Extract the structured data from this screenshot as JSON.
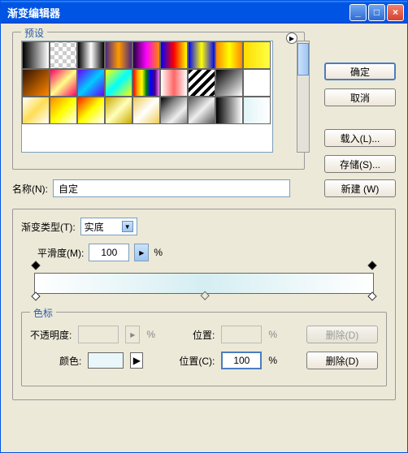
{
  "titlebar": {
    "title": "渐变编辑器"
  },
  "buttons": {
    "ok": "确定",
    "cancel": "取消",
    "load": "载入(L)...",
    "save": "存储(S)...",
    "new": "新建 (W)",
    "delete_opacity": "删除(D)",
    "delete_color": "删除(D)"
  },
  "presets": {
    "legend": "预设"
  },
  "name": {
    "label": "名称(N):",
    "value": "自定"
  },
  "gradient": {
    "type_label": "渐变类型(T):",
    "type_value": "实底",
    "smooth_label": "平滑度(M):",
    "smooth_value": "100",
    "smooth_unit": "%"
  },
  "stops": {
    "legend": "色标",
    "opacity_label": "不透明度:",
    "opacity_value": "",
    "opacity_unit": "%",
    "opacity_pos_label": "位置:",
    "opacity_pos_value": "",
    "opacity_pos_unit": "%",
    "color_label": "颜色:",
    "color_pos_label": "位置(C):",
    "color_pos_value": "100",
    "color_pos_unit": "%"
  }
}
